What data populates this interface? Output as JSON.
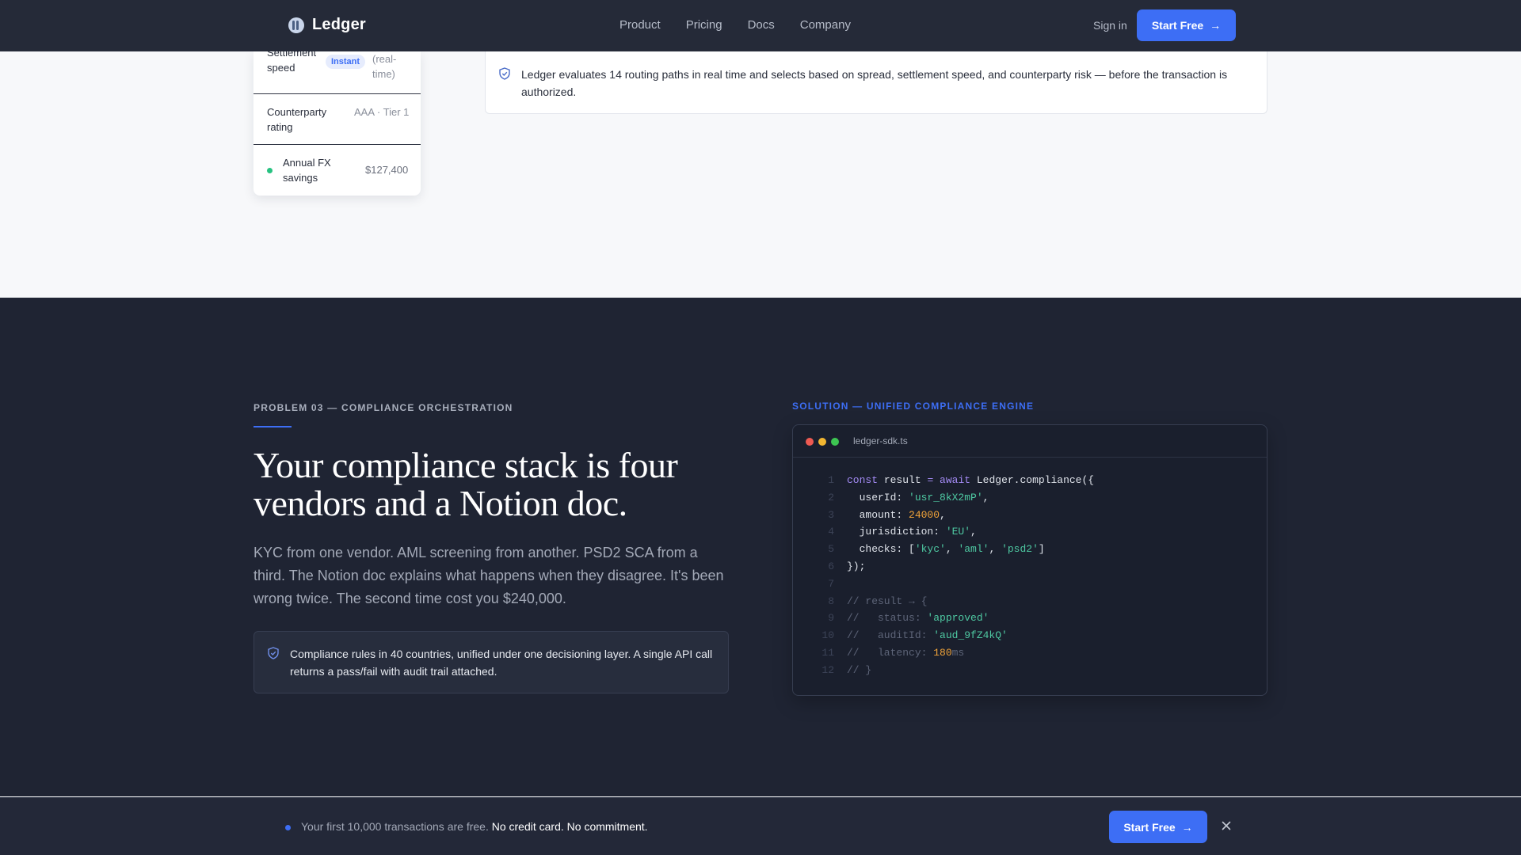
{
  "nav": {
    "brand": "Ledger",
    "links": [
      "Product",
      "Pricing",
      "Docs",
      "Company"
    ],
    "signin": "Sign in",
    "cta": "Start Free"
  },
  "metrics": {
    "rows": [
      {
        "label": "Settlement speed",
        "badge": "Instant",
        "value": "(real-time)"
      },
      {
        "label": "Counterparty rating",
        "value": "AAA · Tier 1"
      },
      {
        "label": "Annual FX savings",
        "value": "$127,400"
      }
    ]
  },
  "routing_note": "Ledger evaluates 14 routing paths in real time and selects based on spread, settlement speed, and counterparty risk — before the transaction is authorized.",
  "problem": {
    "eyebrow": "PROBLEM 03 — COMPLIANCE ORCHESTRATION",
    "headline": "Your compliance stack is four vendors and a Notion doc.",
    "body": "KYC from one vendor. AML screening from another. PSD2 SCA from a third. The Notion doc explains what happens when they disagree. It's been wrong twice. The second time cost you $240,000.",
    "note": "Compliance rules in 40 countries, unified under one decisioning layer. A single API call returns a pass/fail with audit trail attached."
  },
  "solution": {
    "eyebrow": "SOLUTION — UNIFIED COMPLIANCE ENGINE",
    "filename": "ledger-sdk.ts",
    "line_numbers": [
      "1",
      "2",
      "3",
      "4",
      "5",
      "6",
      "7",
      "8",
      "9",
      "10",
      "11",
      "12"
    ],
    "code": {
      "l1": {
        "kw1": "const",
        "t1": " result ",
        "op": "=",
        "kw2": " await",
        "t2": " Ledger.compliance({"
      },
      "l2": {
        "t1": "  userId: ",
        "s1": "'usr_8kX2mP'",
        "t2": ","
      },
      "l3": {
        "t1": "  amount: ",
        "n1": "24000",
        "t2": ","
      },
      "l4": {
        "t1": "  jurisdiction: ",
        "s1": "'EU'",
        "t2": ","
      },
      "l5": {
        "t1": "  checks: [",
        "s1": "'kyc'",
        "t2": ", ",
        "s2": "'aml'",
        "t3": ", ",
        "s3": "'psd2'",
        "t4": "]"
      },
      "l6": {
        "t1": "});"
      },
      "l8": {
        "c1": "// result → {"
      },
      "l9": {
        "c1": "//   status: ",
        "s1": "'approved'"
      },
      "l10": {
        "c1": "//   auditId: ",
        "s1": "'aud_9fZ4kQ'"
      },
      "l11": {
        "c1": "//   latency: ",
        "n1": "180",
        "c2": "ms"
      },
      "l12": {
        "c1": "// }"
      }
    }
  },
  "bottom_bar": {
    "text": "Your first 10,000 transactions are free.",
    "emphasis": "No credit card. No commitment.",
    "cta": "Start Free"
  },
  "icons": {
    "brand": "ledger-logo-icon",
    "shield": "shield-check-icon",
    "arrow": "arrow-right-icon",
    "close": "close-icon"
  },
  "colors": {
    "accent": "#3d6ef5",
    "dark_bg": "#1f2433",
    "nav_bg": "#252a38",
    "success": "#27c281"
  }
}
